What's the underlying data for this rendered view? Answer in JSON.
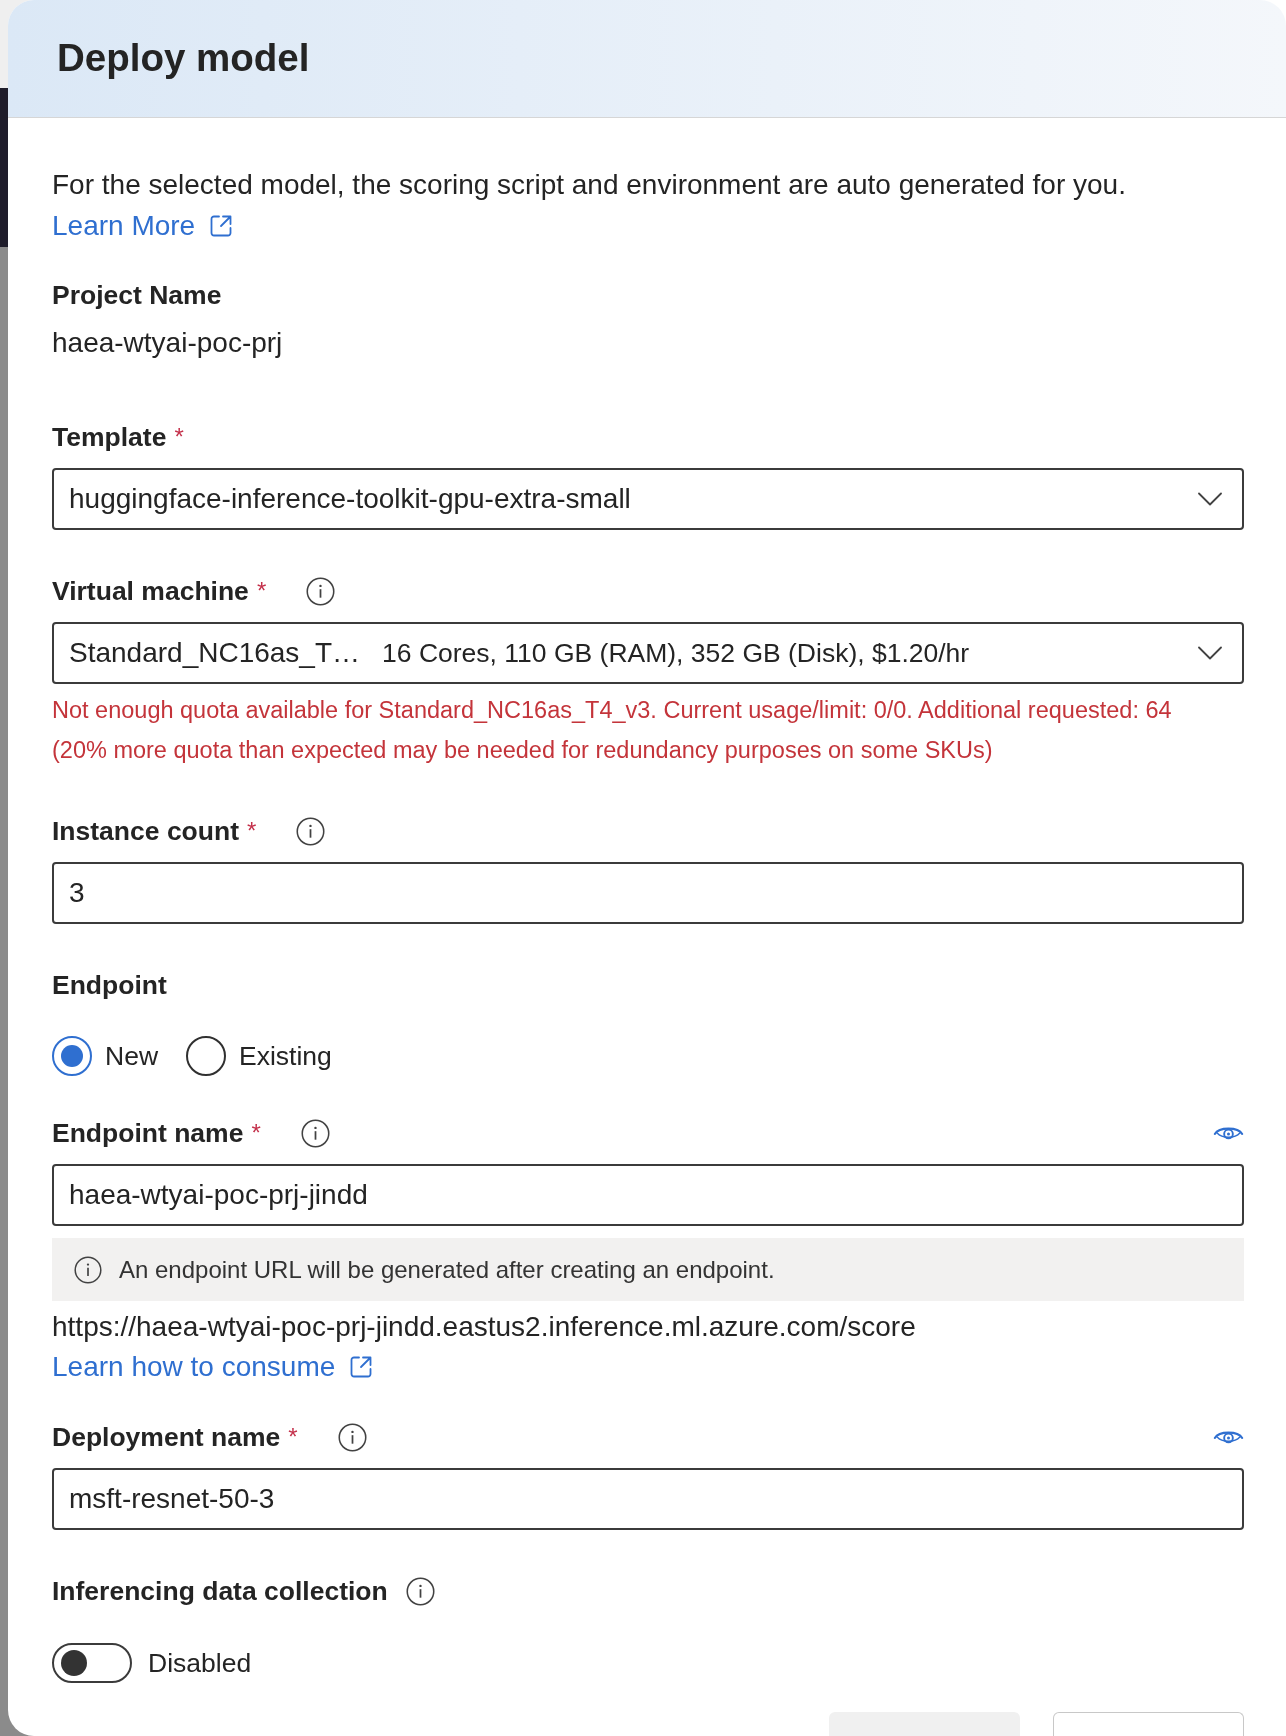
{
  "panel": {
    "title": "Deploy model"
  },
  "intro": {
    "text": "For the selected model, the scoring script and environment are auto generated for you.",
    "link": "Learn More"
  },
  "form": [
    {
      "kind": "readonly",
      "label": "Project Name",
      "value": "haea-wtyai-poc-prj"
    },
    {
      "kind": "dropdown",
      "label": "Template",
      "required_marker": "*",
      "value": "huggingface-inference-toolkit-gpu-extra-small"
    },
    {
      "kind": "dropdown",
      "label": "Virtual machine",
      "required_marker": "*",
      "info": true,
      "value": "Standard_NC16as_T…",
      "detail": "16 Cores, 110 GB (RAM), 352 GB (Disk), $1.20/hr",
      "errors": [
        "Not enough quota available for Standard_NC16as_T4_v3. Current usage/limit: 0/0. Additional requested: 64",
        "(20% more quota than expected may be needed for redundancy purposes on some SKUs)"
      ]
    },
    {
      "kind": "text",
      "label": "Instance count",
      "required_marker": "*",
      "info": true,
      "value": "3"
    },
    {
      "kind": "radio",
      "label": "Endpoint",
      "options": [
        {
          "label": "New",
          "selected": true
        },
        {
          "label": "Existing",
          "selected": false
        }
      ]
    },
    {
      "kind": "text",
      "label": "Endpoint name",
      "required_marker": "*",
      "info": true,
      "reveal": true,
      "value": "haea-wtyai-poc-prj-jindd",
      "notice": "An endpoint URL will be generated after creating an endpoint.",
      "url": "https://haea-wtyai-poc-prj-jindd.eastus2.inference.ml.azure.com/score",
      "link": "Learn how to consume"
    },
    {
      "kind": "text",
      "label": "Deployment name",
      "required_marker": "*",
      "info": true,
      "reveal": true,
      "value": "msft-resnet-50-3"
    },
    {
      "kind": "toggle",
      "label": "Inferencing data collection",
      "info": true,
      "on": false,
      "status": "Disabled"
    }
  ],
  "footer": {
    "buttons": [
      {
        "kind": "primary"
      },
      {
        "kind": "secondary"
      }
    ]
  }
}
